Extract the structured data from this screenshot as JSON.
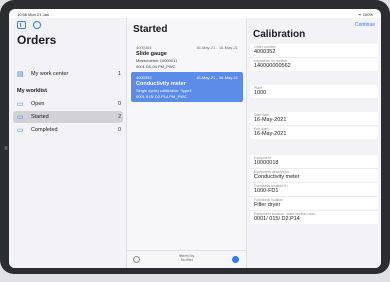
{
  "status": {
    "time": "10:58  Mon 21 Jan",
    "sys": "ᯤ 100%"
  },
  "sidebar": {
    "title": "Orders",
    "my_work_center": {
      "label": "My work center",
      "count": "1"
    },
    "worklist_heading": "My worklist",
    "items": [
      {
        "label": "Open",
        "count": "0"
      },
      {
        "label": "Started",
        "count": "2"
      },
      {
        "label": "Completed",
        "count": "0"
      }
    ]
  },
  "list": {
    "title": "Started",
    "cards": [
      {
        "id": "4000364",
        "dates": "16-May-21 - 16-May-21",
        "title": "Slide gauge",
        "line1": "Messchieber 10000011",
        "line2": "0001  D0-04 PM_PWC"
      },
      {
        "id": "4000352",
        "dates": "16-May-21 - 16-May-21",
        "title": "Conductivity meter",
        "line1": "Single cycle) calibration: *type4",
        "line2": "0001 015/ D2.P14 PM_PWC"
      }
    ],
    "footer": {
      "filter_label": "filtered by:",
      "filter_value": "No filter"
    }
  },
  "detail": {
    "continue_label": "Continue",
    "title": "Calibration",
    "fields": [
      {
        "label": "Order number",
        "value": "4000352"
      },
      {
        "label": "Inspection lot number",
        "value": "140000000562"
      },
      {
        "label": "Plant",
        "value": "1000"
      },
      {
        "label": "Start date",
        "value": "16-May-2021"
      },
      {
        "label": "End date",
        "value": "16-May-2021"
      },
      {
        "label": "Equipment",
        "value": "10000018"
      },
      {
        "label": "Equipment description",
        "value": "Conductivity meter"
      },
      {
        "label": "Functional location ID",
        "value": "1000-FD1"
      },
      {
        "label": "Functional location",
        "value": "Filter dryer"
      },
      {
        "label": "Equipment location / plant section room",
        "value": "0001/ 015/ D2.P14"
      }
    ]
  }
}
